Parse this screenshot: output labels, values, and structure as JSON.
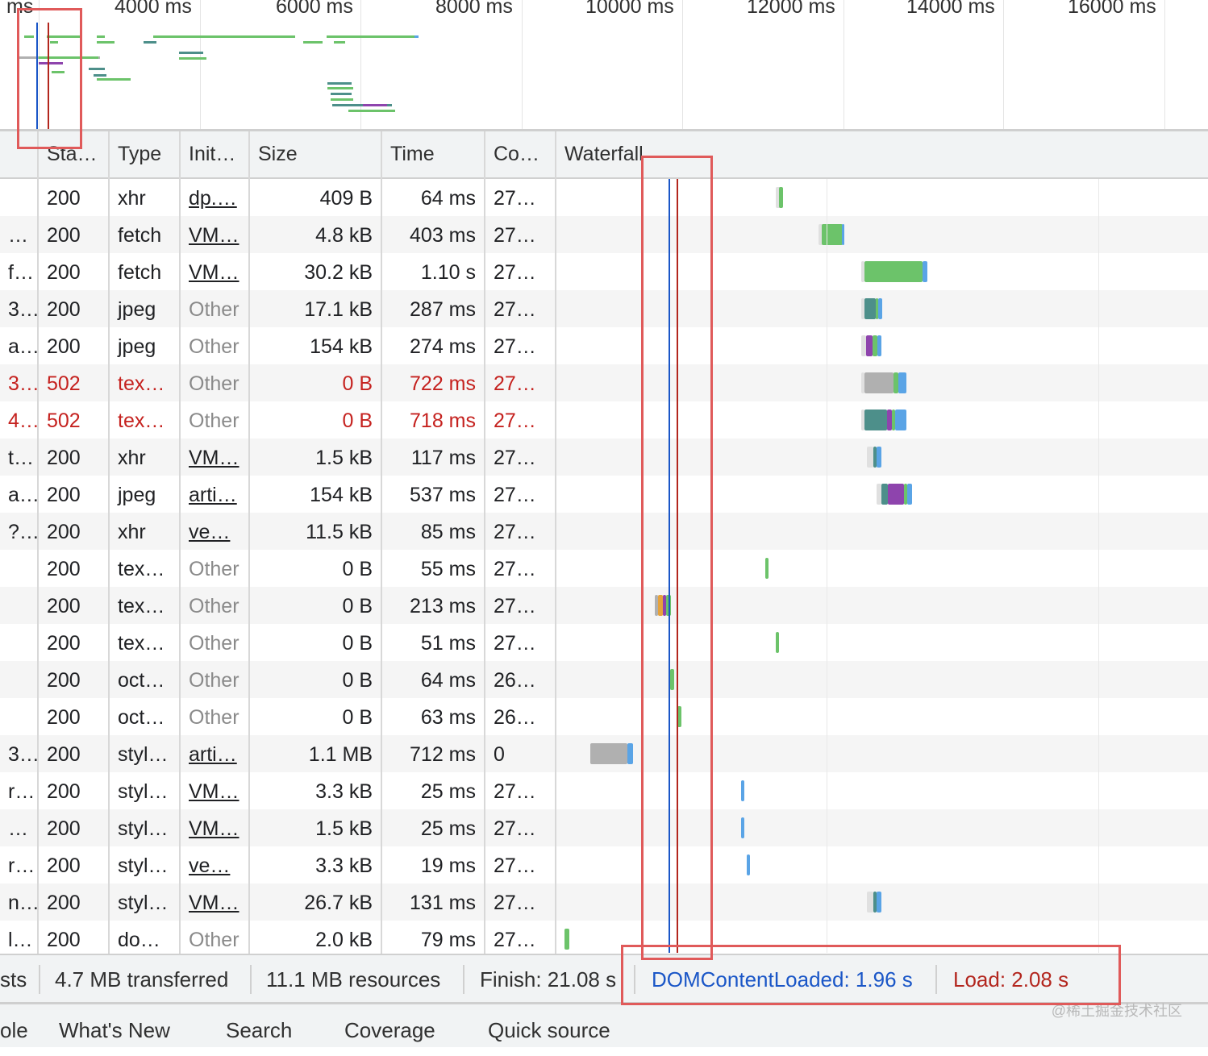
{
  "overview": {
    "time_labels": [
      "ms",
      "4000 ms",
      "6000 ms",
      "8000 ms",
      "10000 ms",
      "12000 ms",
      "14000 ms",
      "16000 ms"
    ]
  },
  "columns": {
    "status": "Sta…",
    "type": "Type",
    "initiator": "Init…",
    "size": "Size",
    "time": "Time",
    "connection": "Co…",
    "waterfall": "Waterfall"
  },
  "rows": [
    {
      "name": "",
      "status": "200",
      "type": "xhr",
      "initiator": "dp.…",
      "initiator_link": true,
      "size": "409 B",
      "time": "64 ms",
      "connection": "27…",
      "error": false
    },
    {
      "name": "…",
      "status": "200",
      "type": "fetch",
      "initiator": "VM…",
      "initiator_link": true,
      "size": "4.8 kB",
      "time": "403 ms",
      "connection": "27…",
      "error": false
    },
    {
      "name": "f…",
      "status": "200",
      "type": "fetch",
      "initiator": "VM…",
      "initiator_link": true,
      "size": "30.2 kB",
      "time": "1.10 s",
      "connection": "27…",
      "error": false
    },
    {
      "name": "3…",
      "status": "200",
      "type": "jpeg",
      "initiator": "Other",
      "initiator_link": false,
      "size": "17.1 kB",
      "time": "287 ms",
      "connection": "27…",
      "error": false
    },
    {
      "name": "a…",
      "status": "200",
      "type": "jpeg",
      "initiator": "Other",
      "initiator_link": false,
      "size": "154 kB",
      "time": "274 ms",
      "connection": "27…",
      "error": false
    },
    {
      "name": "3…",
      "status": "502",
      "type": "tex…",
      "initiator": "Other",
      "initiator_link": false,
      "size": "0 B",
      "time": "722 ms",
      "connection": "27…",
      "error": true
    },
    {
      "name": "4…",
      "status": "502",
      "type": "tex…",
      "initiator": "Other",
      "initiator_link": false,
      "size": "0 B",
      "time": "718 ms",
      "connection": "27…",
      "error": true
    },
    {
      "name": "t…",
      "status": "200",
      "type": "xhr",
      "initiator": "VM…",
      "initiator_link": true,
      "size": "1.5 kB",
      "time": "117 ms",
      "connection": "27…",
      "error": false
    },
    {
      "name": "a…",
      "status": "200",
      "type": "jpeg",
      "initiator": "arti…",
      "initiator_link": true,
      "size": "154 kB",
      "time": "537 ms",
      "connection": "27…",
      "error": false
    },
    {
      "name": "?…",
      "status": "200",
      "type": "xhr",
      "initiator": "ve…",
      "initiator_link": true,
      "size": "11.5 kB",
      "time": "85 ms",
      "connection": "27…",
      "error": false
    },
    {
      "name": "",
      "status": "200",
      "type": "tex…",
      "initiator": "Other",
      "initiator_link": false,
      "size": "0 B",
      "time": "55 ms",
      "connection": "27…",
      "error": false
    },
    {
      "name": "",
      "status": "200",
      "type": "tex…",
      "initiator": "Other",
      "initiator_link": false,
      "size": "0 B",
      "time": "213 ms",
      "connection": "27…",
      "error": false
    },
    {
      "name": "",
      "status": "200",
      "type": "tex…",
      "initiator": "Other",
      "initiator_link": false,
      "size": "0 B",
      "time": "51 ms",
      "connection": "27…",
      "error": false
    },
    {
      "name": "",
      "status": "200",
      "type": "oct…",
      "initiator": "Other",
      "initiator_link": false,
      "size": "0 B",
      "time": "64 ms",
      "connection": "26…",
      "error": false
    },
    {
      "name": "",
      "status": "200",
      "type": "oct…",
      "initiator": "Other",
      "initiator_link": false,
      "size": "0 B",
      "time": "63 ms",
      "connection": "26…",
      "error": false
    },
    {
      "name": "3…",
      "status": "200",
      "type": "styl…",
      "initiator": "arti…",
      "initiator_link": true,
      "size": "1.1 MB",
      "time": "712 ms",
      "connection": "0",
      "error": false
    },
    {
      "name": "r…",
      "status": "200",
      "type": "styl…",
      "initiator": "VM…",
      "initiator_link": true,
      "size": "3.3 kB",
      "time": "25 ms",
      "connection": "27…",
      "error": false
    },
    {
      "name": "…",
      "status": "200",
      "type": "styl…",
      "initiator": "VM…",
      "initiator_link": true,
      "size": "1.5 kB",
      "time": "25 ms",
      "connection": "27…",
      "error": false
    },
    {
      "name": "r…",
      "status": "200",
      "type": "styl…",
      "initiator": "ve…",
      "initiator_link": true,
      "size": "3.3 kB",
      "time": "19 ms",
      "connection": "27…",
      "error": false
    },
    {
      "name": "n…",
      "status": "200",
      "type": "styl…",
      "initiator": "VM…",
      "initiator_link": true,
      "size": "26.7 kB",
      "time": "131 ms",
      "connection": "27…",
      "error": false
    },
    {
      "name": "l…",
      "status": "200",
      "type": "do…",
      "initiator": "Other",
      "initiator_link": false,
      "size": "2.0 kB",
      "time": "79 ms",
      "connection": "27…",
      "error": false
    }
  ],
  "status_bar": {
    "requests": "sts",
    "transferred": "4.7 MB transferred",
    "resources": "11.1 MB resources",
    "finish": "Finish: 21.08 s",
    "dom_content_loaded": "DOMContentLoaded: 1.96 s",
    "load": "Load: 2.08 s"
  },
  "drawer_tabs": [
    "ole",
    "What's New",
    "Search",
    "Coverage",
    "Quick source"
  ],
  "watermark": "@稀土掘金技术社区",
  "colors": {
    "dom_content_loaded": "#1a56c7",
    "load": "#b3261e",
    "error": "#c5221f",
    "annotation": "#e05a5a",
    "bar_green": "#6cc36a",
    "bar_blue": "#5aa4e6",
    "bar_gray": "#b0b0b0",
    "bar_teal": "#4d8f8a",
    "bar_purple": "#8e44ad"
  }
}
